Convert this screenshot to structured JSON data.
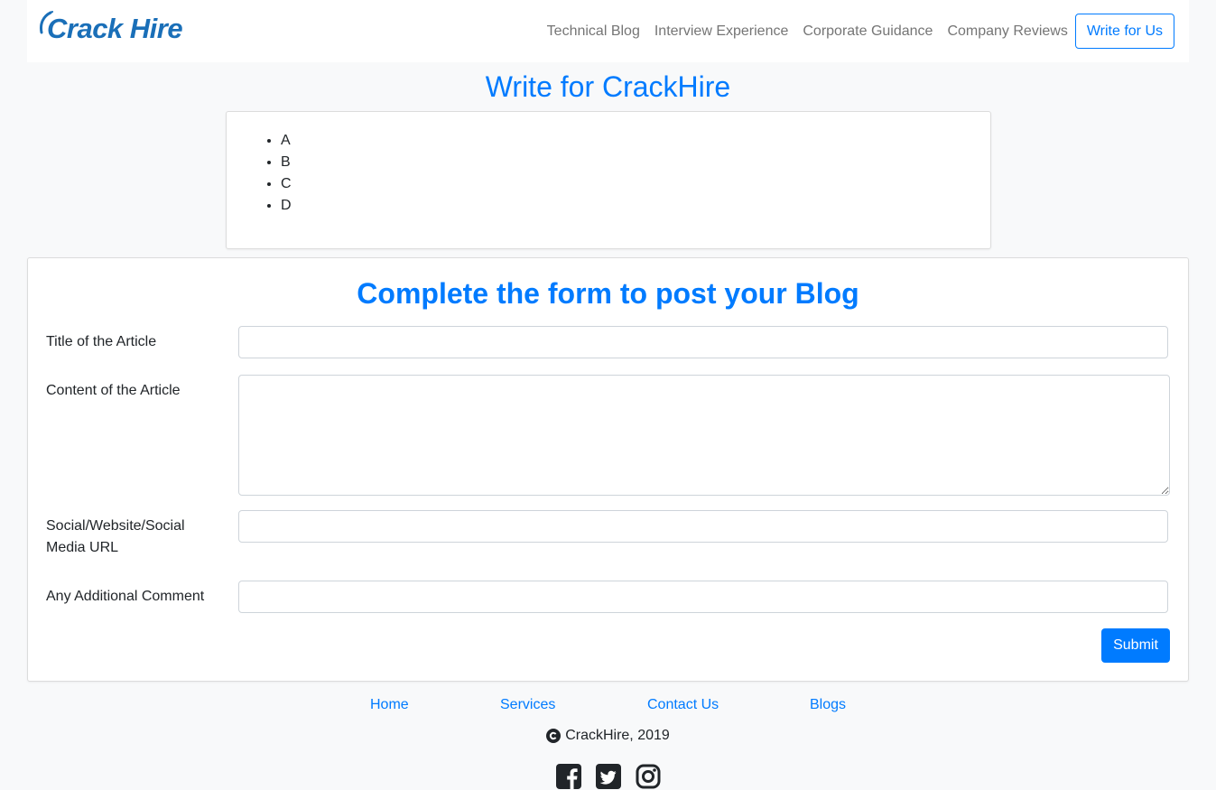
{
  "brand": {
    "name": "Crack Hire",
    "color": "#1a6fb8"
  },
  "nav": {
    "links": [
      "Technical Blog",
      "Interview Experience",
      "Corporate Guidance",
      "Company Reviews"
    ],
    "cta": "Write for Us"
  },
  "page": {
    "title": "Write for CrackHire"
  },
  "guidelines": {
    "items": [
      "A",
      "B",
      "C",
      "D"
    ]
  },
  "form": {
    "heading": "Complete the form to post your Blog",
    "fields": [
      {
        "label": "Title of the Article",
        "value": ""
      },
      {
        "label": "Content of the Article",
        "value": ""
      },
      {
        "label": "Social/Website/Social Media URL",
        "value": ""
      },
      {
        "label": "Any Additional Comment",
        "value": ""
      }
    ],
    "submit_label": "Submit"
  },
  "footer": {
    "links": [
      "Home",
      "Services",
      "Contact Us",
      "Blogs"
    ],
    "copyright": "CrackHire, 2019",
    "social_icons": [
      "facebook-icon",
      "twitter-icon",
      "instagram-icon"
    ]
  },
  "colors": {
    "accent": "#007bff",
    "background": "#f8f9fa",
    "nav_text": "#757575"
  }
}
